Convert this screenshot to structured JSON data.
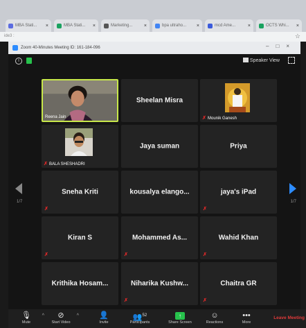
{
  "browser": {
    "tabs": [
      {
        "title": "MBA Stati...",
        "color": "#5b6ce0"
      },
      {
        "title": "MBA Stati...",
        "color": "#1aa260"
      },
      {
        "title": "Marketing...",
        "color": "#555555"
      },
      {
        "title": "bpa ultraho...",
        "color": "#4285f4"
      },
      {
        "title": "mcd Ame...",
        "color": "#3b5bdb"
      },
      {
        "title": "OCTS Whi...",
        "color": "#1aa260"
      }
    ],
    "address": "ide3 :"
  },
  "zoom_window": {
    "title": "Zoom 40-Minutes Meeting ID: 161-184-096"
  },
  "meeting": {
    "speaker_view_label": "Speaker View",
    "page_left": "1/7",
    "page_right": "1/7",
    "participants": [
      {
        "name": "Reena Jain",
        "video": true,
        "active": true,
        "muted": false
      },
      {
        "name": "Sheelan Misra",
        "video": false,
        "muted": false
      },
      {
        "name": "Mounik Ganesh",
        "video": true,
        "muted": true
      },
      {
        "name": "BALA SHESHADRI",
        "video": true,
        "muted": true
      },
      {
        "name": "Jaya suman",
        "video": false,
        "muted": false
      },
      {
        "name": "Priya",
        "video": false,
        "muted": false
      },
      {
        "name": "Sneha Kriti",
        "video": false,
        "muted": true
      },
      {
        "name": "kousalya elango...",
        "video": false,
        "muted": false
      },
      {
        "name": "jaya's iPad",
        "video": false,
        "muted": true
      },
      {
        "name": "Kiran S",
        "video": false,
        "muted": true
      },
      {
        "name": "Mohammed As...",
        "video": false,
        "muted": true
      },
      {
        "name": "Wahid Khan",
        "video": false,
        "muted": true
      },
      {
        "name": "Krithika Hosam...",
        "video": false,
        "muted": false
      },
      {
        "name": "Niharika Kushw...",
        "video": false,
        "muted": true
      },
      {
        "name": "Chaitra GR",
        "video": false,
        "muted": true
      }
    ]
  },
  "toolbar": {
    "mute": "Mute",
    "start_video": "Start Video",
    "invite": "Invite",
    "participants": "Participants",
    "participant_count": "52",
    "share_screen": "Share Screen",
    "reactions": "Reactions",
    "more": "More",
    "leave": "Leave Meeting"
  },
  "colors": {
    "accent": "#2d8cff",
    "active_speaker": "#c8e84a",
    "mute_red": "#e02828",
    "leave_red": "#e03a3a",
    "share_green": "#27c24c"
  }
}
